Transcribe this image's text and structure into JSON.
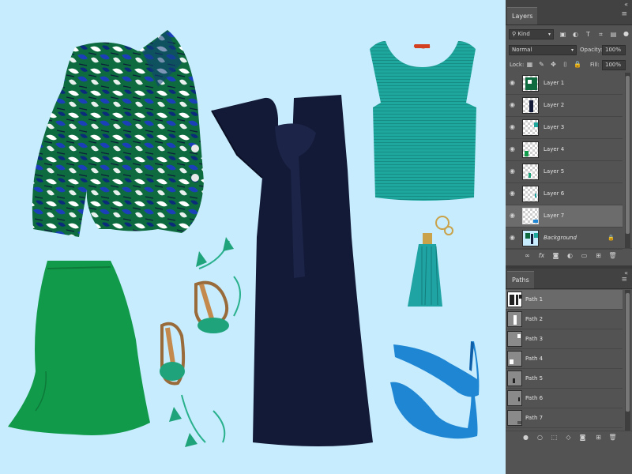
{
  "canvas": {
    "background": "#c6ecfd",
    "items": [
      {
        "name": "printed-jacket"
      },
      {
        "name": "navy-dress"
      },
      {
        "name": "teal-knit-top"
      },
      {
        "name": "green-skirt"
      },
      {
        "name": "tassel-sandals"
      },
      {
        "name": "tassel-keychain"
      },
      {
        "name": "blue-pumps"
      }
    ]
  },
  "layers_panel": {
    "tab_label": "Layers",
    "filter_kind": "Kind",
    "blend_mode": "Normal",
    "opacity_label": "Opacity:",
    "opacity_value": "100%",
    "lock_label": "Lock:",
    "fill_label": "Fill:",
    "fill_value": "100%",
    "layers": [
      {
        "name": "Layer 1",
        "selected": false,
        "thumb": "jacket"
      },
      {
        "name": "Layer 2",
        "selected": false,
        "thumb": "dress"
      },
      {
        "name": "Layer 3",
        "selected": false,
        "thumb": "top"
      },
      {
        "name": "Layer 4",
        "selected": false,
        "thumb": "skirt"
      },
      {
        "name": "Layer 5",
        "selected": false,
        "thumb": "sandals"
      },
      {
        "name": "Layer 6",
        "selected": false,
        "thumb": "keychain"
      },
      {
        "name": "Layer 7",
        "selected": true,
        "thumb": "pumps"
      },
      {
        "name": "Background",
        "selected": false,
        "thumb": "background",
        "locked": true
      }
    ]
  },
  "paths_panel": {
    "tab_label": "Paths",
    "paths": [
      {
        "name": "Path 1",
        "selected": true
      },
      {
        "name": "Path 2",
        "selected": false
      },
      {
        "name": "Path 3",
        "selected": false
      },
      {
        "name": "Path 4",
        "selected": false
      },
      {
        "name": "Path 5",
        "selected": false
      },
      {
        "name": "Path 6",
        "selected": false
      },
      {
        "name": "Path 7",
        "selected": false
      }
    ]
  },
  "colors": {
    "panel_bg": "#535353",
    "panel_dark": "#424242",
    "selected_row": "#6c6c6c",
    "navy": "#141b38",
    "teal": "#1fa39a",
    "green": "#129a4b",
    "blue": "#1f86d3"
  }
}
